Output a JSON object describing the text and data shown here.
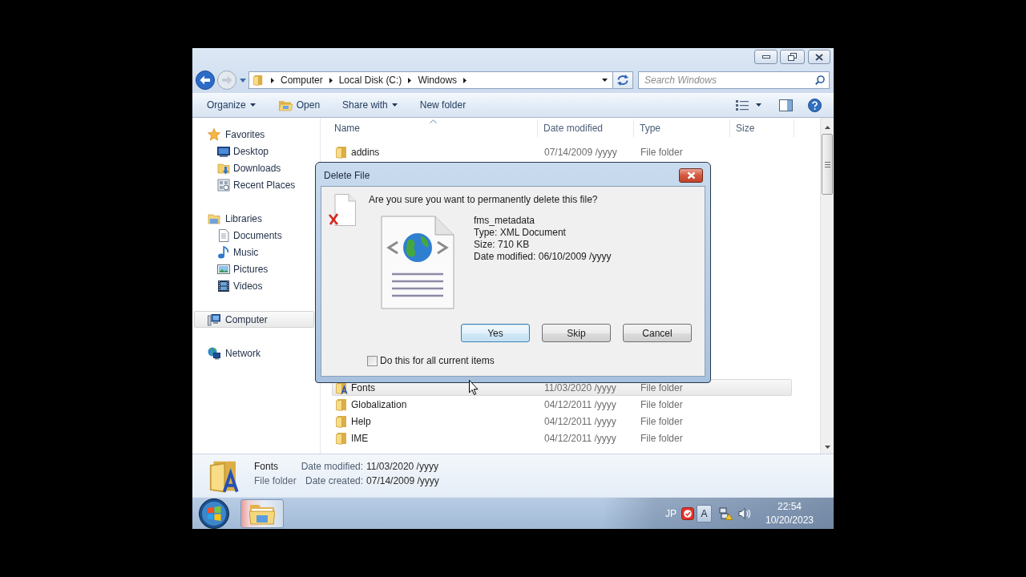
{
  "address_bar": {
    "breadcrumbs": [
      "Computer",
      "Local Disk (C:)",
      "Windows"
    ]
  },
  "search": {
    "placeholder": "Search Windows"
  },
  "toolbar": {
    "buttons": [
      {
        "label": "Organize",
        "kind": "dropdown"
      },
      {
        "label": "Open",
        "kind": "open"
      },
      {
        "label": "Share with",
        "kind": "dropdown"
      },
      {
        "label": "New folder",
        "kind": "plain"
      }
    ]
  },
  "sidebar": {
    "items": [
      {
        "label": "Favorites",
        "kind": "favorites",
        "selected": false,
        "children": [
          {
            "label": "Desktop",
            "kind": "desktop",
            "selected": false
          },
          {
            "label": "Downloads",
            "kind": "downloads",
            "selected": false
          },
          {
            "label": "Recent Places",
            "kind": "recent",
            "selected": false
          }
        ]
      },
      {
        "label": "Libraries",
        "kind": "libraries",
        "selected": false,
        "children": [
          {
            "label": "Documents",
            "kind": "documents",
            "selected": false
          },
          {
            "label": "Music",
            "kind": "music",
            "selected": false
          },
          {
            "label": "Pictures",
            "kind": "pictures",
            "selected": false
          },
          {
            "label": "Videos",
            "kind": "videos",
            "selected": false
          }
        ]
      },
      {
        "label": "Computer",
        "kind": "computer",
        "selected": true
      },
      {
        "label": "Network",
        "kind": "network",
        "selected": false
      }
    ]
  },
  "file_list": {
    "columns": [
      {
        "label": "Name",
        "sorted": true
      },
      {
        "label": "Date modified",
        "sorted": false
      },
      {
        "label": "Type",
        "sorted": false
      },
      {
        "label": "Size",
        "sorted": false
      }
    ],
    "rows_above_dialog": [
      {
        "name": "addins",
        "date_modified": "07/14/2009 /yyyy",
        "type": "File folder",
        "kind": "folder",
        "selected": false
      }
    ],
    "rows_below_dialog": [
      {
        "name": "Fonts",
        "date_modified": "11/03/2020 /yyyy",
        "type": "File folder",
        "kind": "fonts",
        "selected": true
      },
      {
        "name": "Globalization",
        "date_modified": "04/12/2011 /yyyy",
        "type": "File folder",
        "kind": "folder",
        "selected": false
      },
      {
        "name": "Help",
        "date_modified": "04/12/2011 /yyyy",
        "type": "File folder",
        "kind": "folder",
        "selected": false
      },
      {
        "name": "IME",
        "date_modified": "04/12/2011 /yyyy",
        "type": "File folder",
        "kind": "folder",
        "selected": false
      }
    ]
  },
  "details_pane": {
    "name": "Fonts",
    "type": "File folder",
    "kind": "fonts",
    "fields": [
      {
        "label": "Date modified:",
        "value": "11/03/2020 /yyyy"
      },
      {
        "label": "Date created:",
        "value": "07/14/2009 /yyyy"
      }
    ]
  },
  "dialog": {
    "title": "Delete File",
    "question": "Are you sure you want to permanently delete this file?",
    "file": {
      "name": "fms_metadata",
      "details": [
        "Type: XML Document",
        "Size: 710 KB",
        "Date modified: 06/10/2009 /yyyy"
      ]
    },
    "buttons": [
      {
        "label": "Yes",
        "selected": true
      },
      {
        "label": "Skip",
        "selected": false
      },
      {
        "label": "Cancel",
        "selected": false
      }
    ],
    "checkbox": {
      "label": "Do this for all current items",
      "checked": false
    }
  },
  "taskbar": {
    "apps": [
      {
        "kind": "explorer",
        "selected": true
      }
    ],
    "tray": {
      "language": "JP",
      "ime_mode": "A",
      "time": "22:54",
      "date": "10/20/2023"
    }
  }
}
